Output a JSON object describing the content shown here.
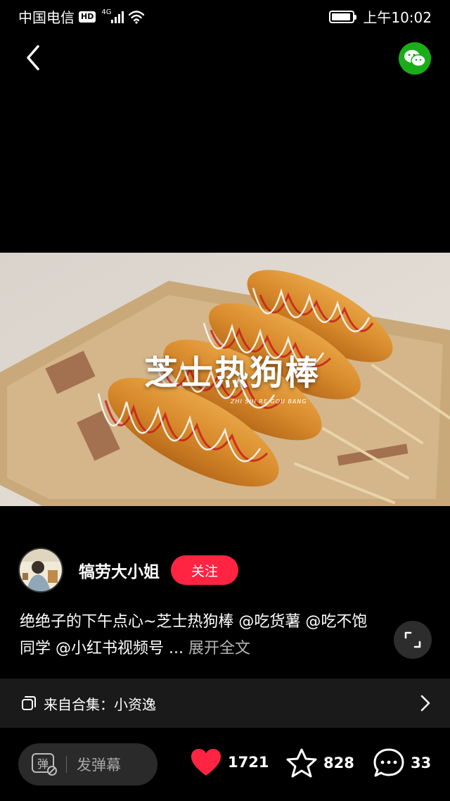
{
  "status_bar": {
    "carrier": "中国电信",
    "hd": "HD",
    "network": "4G",
    "signal_bars": 4,
    "wifi": "wifi-icon",
    "battery_level": 0.9,
    "time": "上午10:02"
  },
  "nav": {
    "back": "chevron-left-icon",
    "share": "wechat-icon"
  },
  "video": {
    "title_overlay": "芝士热狗棒",
    "subtitle_overlay": "ZHI SHI RE GOU BANG"
  },
  "author": {
    "name": "犒劳大小姐",
    "follow_label": "关注"
  },
  "description": {
    "text": "绝绝子的下午点心~芝士热狗棒 @吃货薯 @吃不饱同学 @小红书视频号 ...",
    "expand_label": " 展开全文"
  },
  "collection": {
    "label": "来自合集：小资逸"
  },
  "bottom": {
    "danmaku_icon_text": "弹",
    "danmaku_placeholder": "发弹幕",
    "likes": "1721",
    "favorites": "828",
    "comments": "33"
  },
  "colors": {
    "accent": "#ff2442",
    "wechat": "#1aad19",
    "background": "#000000"
  }
}
